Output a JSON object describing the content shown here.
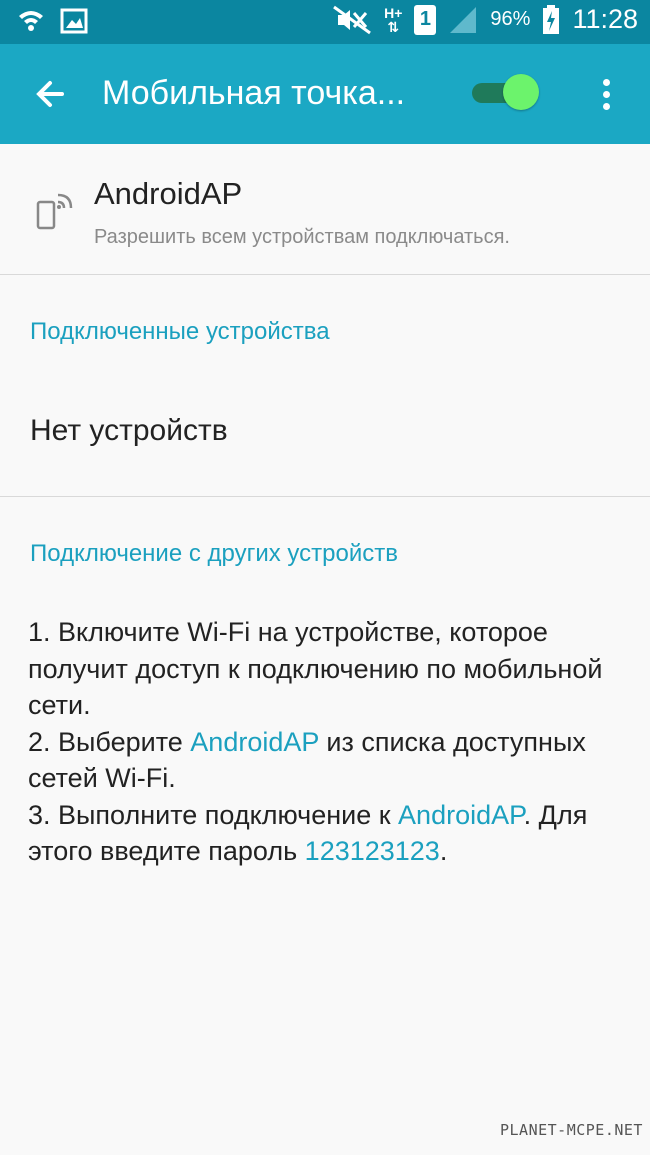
{
  "status_bar": {
    "battery_percent": "96%",
    "clock": "11:28",
    "sim_badge": "1",
    "network_type": "H+",
    "icons": [
      "wifi-icon",
      "gallery-icon",
      "mute-icon",
      "data-arrows-icon",
      "sim-icon",
      "signal-icon",
      "battery-charging-icon"
    ]
  },
  "app_bar": {
    "title": "Мобильная точка...",
    "toggle_on": true
  },
  "ap": {
    "name": "AndroidAP",
    "subtitle": "Разрешить всем устройствам подключаться."
  },
  "connected": {
    "header": "Подключенные устройства",
    "empty_text": "Нет устройств"
  },
  "other_devices": {
    "header": "Подключение с других устройств",
    "step1": "1. Включите Wi-Fi на устройстве, которое получит доступ к подключению по мобильной сети.",
    "step2_pre": "2. Выберите ",
    "step2_link": "AndroidAP",
    "step2_post": " из списка доступных сетей Wi-Fi.",
    "step3_pre": "3. Выполните подключение к ",
    "step3_link": "AndroidAP",
    "step3_mid": ". Для этого введите пароль ",
    "step3_password": "123123123",
    "step3_post": "."
  },
  "watermark": "PLANET-MCPE.NET",
  "colors": {
    "status_bar": "#0b86a0",
    "app_bar": "#1ba8c4",
    "accent": "#1ba0bf",
    "toggle_thumb": "#6cf36c"
  }
}
